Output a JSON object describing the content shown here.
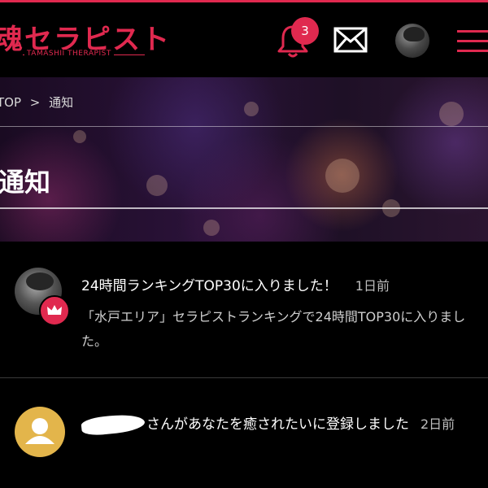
{
  "header": {
    "logo_text": "魂セラピスト",
    "logo_sub": "TAMASHII THERAPIST",
    "notification_count": "3",
    "icons": [
      "bell-icon",
      "mail-icon",
      "avatar",
      "hamburger-menu-icon"
    ],
    "accent_color": "#e0294f"
  },
  "breadcrumb": {
    "home": "TOP",
    "separator": ">",
    "current": "通知"
  },
  "page": {
    "title": "通知"
  },
  "notifications": [
    {
      "title": "24時間ランキングTOP30に入りました！",
      "time": "1日前",
      "body": "「水戸エリア」セラピストランキングで24時間TOP30に入りました。",
      "badge_icon": "crown-icon"
    },
    {
      "title": "さんがあなたを癒されたいに登録しました",
      "time": "2日前",
      "avatar_icon": "user-icon"
    }
  ]
}
